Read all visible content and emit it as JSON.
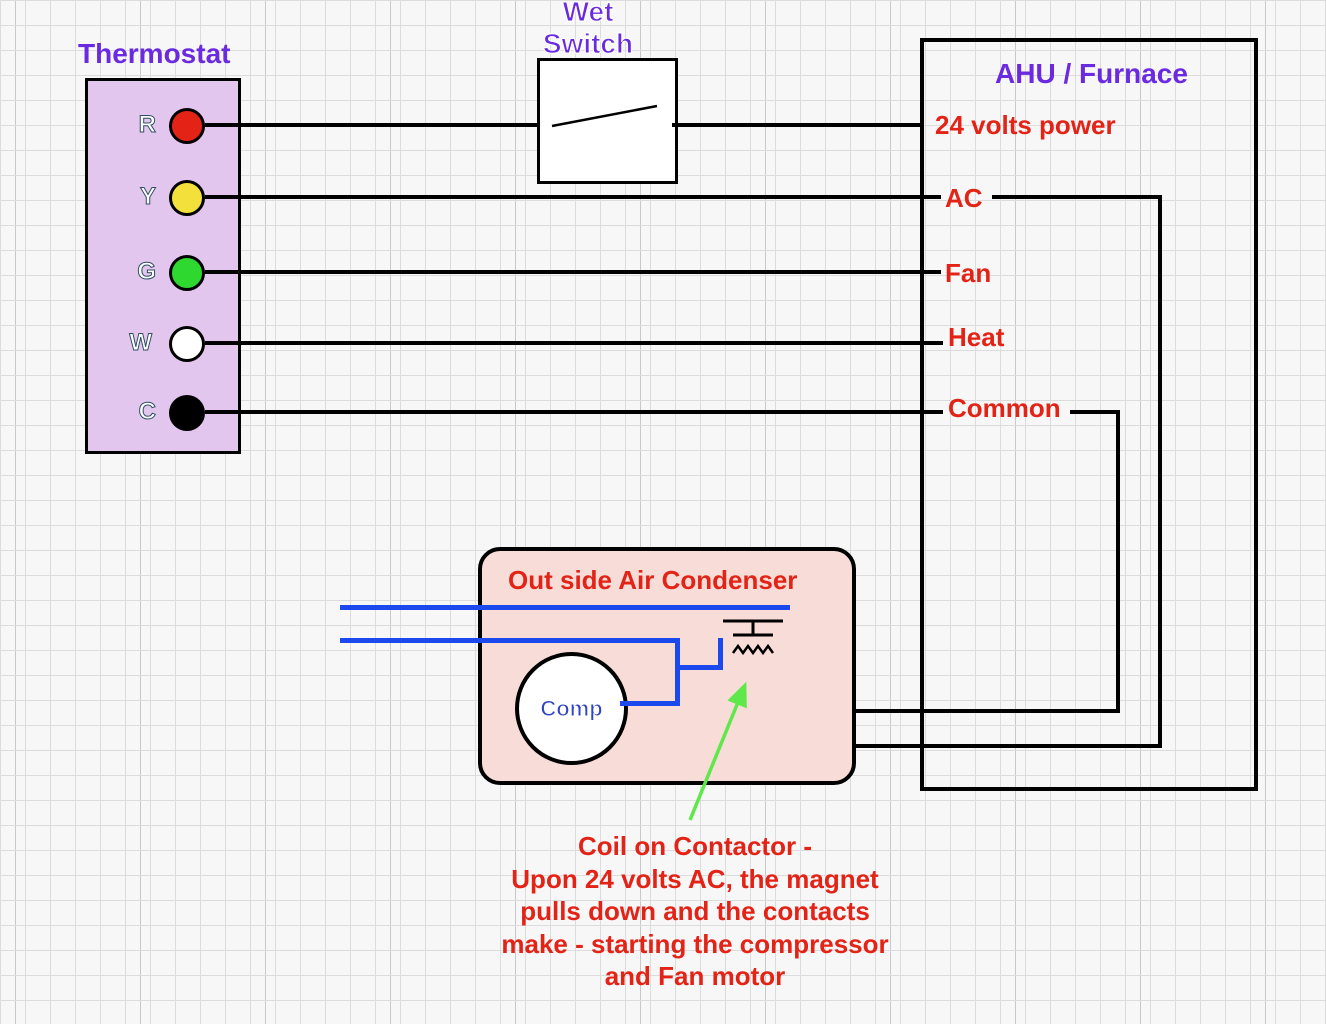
{
  "thermostat": {
    "title": "Thermostat",
    "terminals": [
      {
        "label": "R",
        "color": "#e42317"
      },
      {
        "label": "Y",
        "color": "#f4e03a"
      },
      {
        "label": "G",
        "color": "#2fd82f"
      },
      {
        "label": "W",
        "color": "#ffffff"
      },
      {
        "label": "C",
        "color": "#000000"
      }
    ]
  },
  "wet_switch": {
    "title": "Wet\nSwitch"
  },
  "ahu": {
    "title": "AHU / Furnace",
    "lines": [
      "24 volts power",
      "AC",
      "Fan",
      "Heat",
      "Common"
    ]
  },
  "condenser": {
    "title": "Out side Air Condenser",
    "comp": "Comp"
  },
  "note": "Coil on Contactor -\nUpon 24 volts AC, the magnet\npulls down and the contacts\nmake - starting the compressor\nand Fan motor"
}
